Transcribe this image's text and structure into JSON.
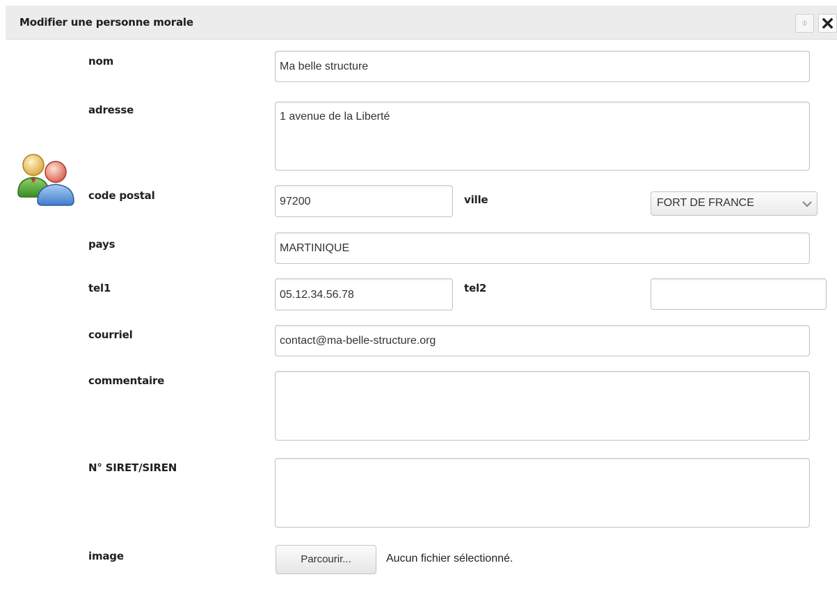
{
  "dialog": {
    "title": "Modifier une personne morale",
    "refresh_icon": "⌽",
    "close_icon": "close-icon"
  },
  "form": {
    "nom": {
      "label": "nom",
      "value": "Ma belle structure"
    },
    "adresse": {
      "label": "adresse",
      "value": "1 avenue de la Liberté"
    },
    "code_postal": {
      "label": "code postal",
      "value": "97200"
    },
    "ville": {
      "label": "ville",
      "selected": "FORT DE FRANCE"
    },
    "pays": {
      "label": "pays",
      "value": "MARTINIQUE"
    },
    "tel1": {
      "label": "tel1",
      "value": "05.12.34.56.78"
    },
    "tel2": {
      "label": "tel2",
      "value": ""
    },
    "courriel": {
      "label": "courriel",
      "value": "contact@ma-belle-structure.org"
    },
    "commentaire": {
      "label": "commentaire",
      "value": ""
    },
    "siret": {
      "label": "N° SIRET/SIREN",
      "value": ""
    },
    "image": {
      "label": "image",
      "button": "Parcourir...",
      "status": "Aucun fichier sélectionné."
    }
  },
  "icons": {
    "users": "users-icon",
    "chevron": "chevron-down-icon"
  },
  "colors": {
    "titlebar_bg": "#ececec",
    "field_border": "#c4c4c4"
  }
}
